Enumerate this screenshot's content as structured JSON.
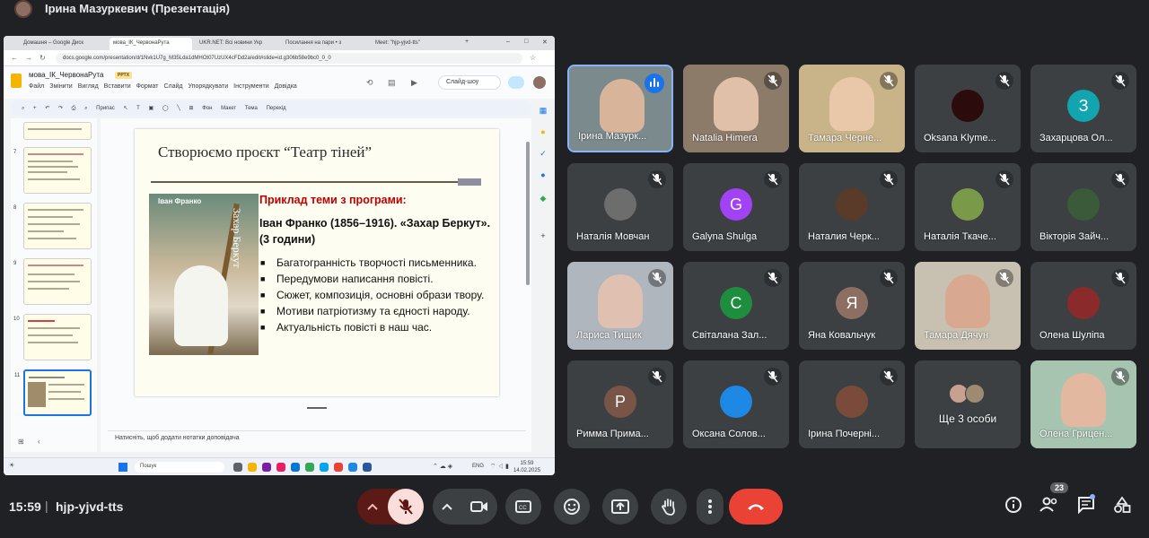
{
  "presenter": {
    "title": "Ірина Мазуркевич (Презентація)"
  },
  "browser": {
    "tabs": [
      {
        "label": "Домашня – Google Диск"
      },
      {
        "label": "мова_ІК_ЧервонаРута"
      },
      {
        "label": "UKR.NET: Всі новини Укр"
      },
      {
        "label": "Посилання на пари • з"
      },
      {
        "label": "Meet: \"hjp-yjvd-tts\""
      }
    ],
    "url": "docs.google.com/presentation/d/1Nvk1U7g_M35Lda1dMHOt07UzUX4cFDd2a/edit#slide=id.g306b58e9bc0_0_0"
  },
  "slides_app": {
    "doc_title": "мова_ІК_ЧервонаРута",
    "file_badge": "PPTX",
    "menu": [
      "Файл",
      "Змінити",
      "Вигляд",
      "Вставити",
      "Формат",
      "Слайд",
      "Упорядкувати",
      "Інструменти",
      "Довідка"
    ],
    "slideshow_label": "Слайд-шоу",
    "toolbar": [
      "Припас",
      "Фон",
      "Макет",
      "Тема",
      "Перехід"
    ],
    "thumb_numbers": [
      "7",
      "8",
      "9",
      "10",
      "11"
    ],
    "notes_placeholder": "Натисніть, щоб додати нотатки доповідача"
  },
  "slide": {
    "title": "Створюємо проєкт “Театр тіней”",
    "cover_author": "Іван Франко",
    "cover_title": "Захар Беркут",
    "example_heading": "Приклад теми з програми:",
    "book": "Іван Франко (1856–1916). «Захар Беркут». (3 години)",
    "bullets": [
      "Багатогранність творчості письменника.",
      "Передумови написання повісті.",
      "Сюжет, композиція, основні образи твору.",
      "Мотиви патріотизму та єдності народу.",
      "Актуальність повісті в наш час."
    ]
  },
  "taskbar": {
    "search": "Пошук",
    "lang": "ENG",
    "time": "15:59",
    "date": "14.02.2025"
  },
  "participants": [
    {
      "name": "Ірина Мазурк...",
      "type": "video",
      "speaking": true,
      "color": "#7b8a8c",
      "skin": "#d8b49a"
    },
    {
      "name": "Natalia Himera",
      "type": "video",
      "color": "#8d7b6a",
      "skin": "#e0c0a8"
    },
    {
      "name": "Тамара Черне...",
      "type": "video",
      "color": "#c9b48a",
      "skin": "#e8c8a8"
    },
    {
      "name": "Oksana Klyme...",
      "type": "photo",
      "color": "#2b0b0b"
    },
    {
      "name": "Захарцова Ол...",
      "type": "letter",
      "letter": "З",
      "color": "#12a4af"
    },
    {
      "name": "Наталія Мовчан",
      "type": "photo",
      "color": "#6d6d6d"
    },
    {
      "name": "Galyna Shulga",
      "type": "letter",
      "letter": "G",
      "color": "#a142f4"
    },
    {
      "name": "Наталия Черк...",
      "type": "photo",
      "color": "#5a3b2a"
    },
    {
      "name": "Наталія Ткаче...",
      "type": "photo",
      "color": "#7a9a4a"
    },
    {
      "name": "Вікторія Зайч...",
      "type": "photo",
      "color": "#3a5a3a"
    },
    {
      "name": "Лариса Тищик",
      "type": "video",
      "color": "#b0b6bd",
      "skin": "#e0c0b0"
    },
    {
      "name": "Світалана Зал...",
      "type": "letter",
      "letter": "C",
      "color": "#1e8e3e"
    },
    {
      "name": "Яна Ковальчук",
      "type": "letter",
      "letter": "Я",
      "color": "#8d6e63"
    },
    {
      "name": "Тамара Дячун",
      "type": "video",
      "color": "#c8c0b0",
      "skin": "#d8a890"
    },
    {
      "name": "Олена Шуліпа",
      "type": "photo",
      "color": "#8b2a2a"
    },
    {
      "name": "Римма Прима...",
      "type": "letter",
      "letter": "Р",
      "color": "#795548"
    },
    {
      "name": "Оксана Солов...",
      "type": "photo",
      "color": "#1e88e5"
    },
    {
      "name": "Ірина Почерні...",
      "type": "photo",
      "color": "#7a4a3a"
    },
    {
      "name": "Ще 3 особи",
      "type": "more"
    },
    {
      "name": "Олена Грицен...",
      "type": "video",
      "color": "#a7c4b0",
      "skin": "#e2b8a0"
    }
  ],
  "bottom": {
    "time": "15:59",
    "separator": "|",
    "meeting_code": "hjp-yjvd-tts",
    "participant_count": "23"
  }
}
